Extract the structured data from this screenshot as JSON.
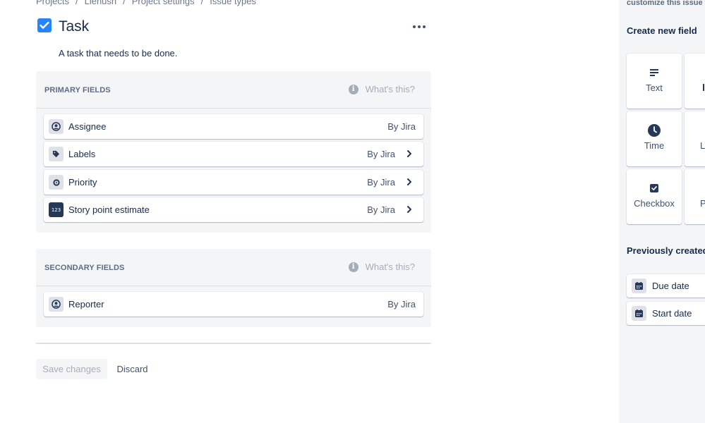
{
  "breadcrumb": [
    "Projects",
    "Lienush",
    "Project settings",
    "Issue types"
  ],
  "header": {
    "title": "Task",
    "description": "A task that needs to be done.",
    "icon": "checkbox-icon",
    "icon_color": "#2684ff"
  },
  "primary": {
    "title": "PRIMARY FIELDS",
    "help": "What's this?",
    "fields": [
      {
        "label": "Assignee",
        "by": "By Jira",
        "icon": "person-icon",
        "chevron": false
      },
      {
        "label": "Labels",
        "by": "By Jira",
        "icon": "tag-icon",
        "chevron": true
      },
      {
        "label": "Priority",
        "by": "By Jira",
        "icon": "priority-icon",
        "chevron": true
      },
      {
        "label": "Story point estimate",
        "by": "By Jira",
        "icon": "number-icon",
        "chevron": true
      }
    ]
  },
  "secondary": {
    "title": "SECONDARY FIELDS",
    "help": "What's this?",
    "fields": [
      {
        "label": "Reporter",
        "by": "By Jira",
        "icon": "person-icon",
        "chevron": false
      }
    ]
  },
  "actions": {
    "save": "Save changes",
    "discard": "Discard"
  },
  "panel": {
    "top_text": "customize this issue typ",
    "create_heading": "Create new field",
    "field_types": [
      {
        "label": "Text",
        "icon": "text-lines-icon"
      },
      {
        "label": "",
        "icon": "partial-card-icon"
      },
      {
        "label": "Time",
        "icon": "clock-icon"
      },
      {
        "label": "L",
        "icon": "partial-card-icon"
      },
      {
        "label": "Checkbox",
        "icon": "checkbox-icon"
      },
      {
        "label": "Pa",
        "icon": "partial-card-icon"
      }
    ],
    "previous_heading": "Previously created f",
    "previous_fields": [
      {
        "label": "Due date",
        "icon": "calendar-icon"
      },
      {
        "label": "Start date",
        "icon": "calendar-icon"
      }
    ]
  }
}
